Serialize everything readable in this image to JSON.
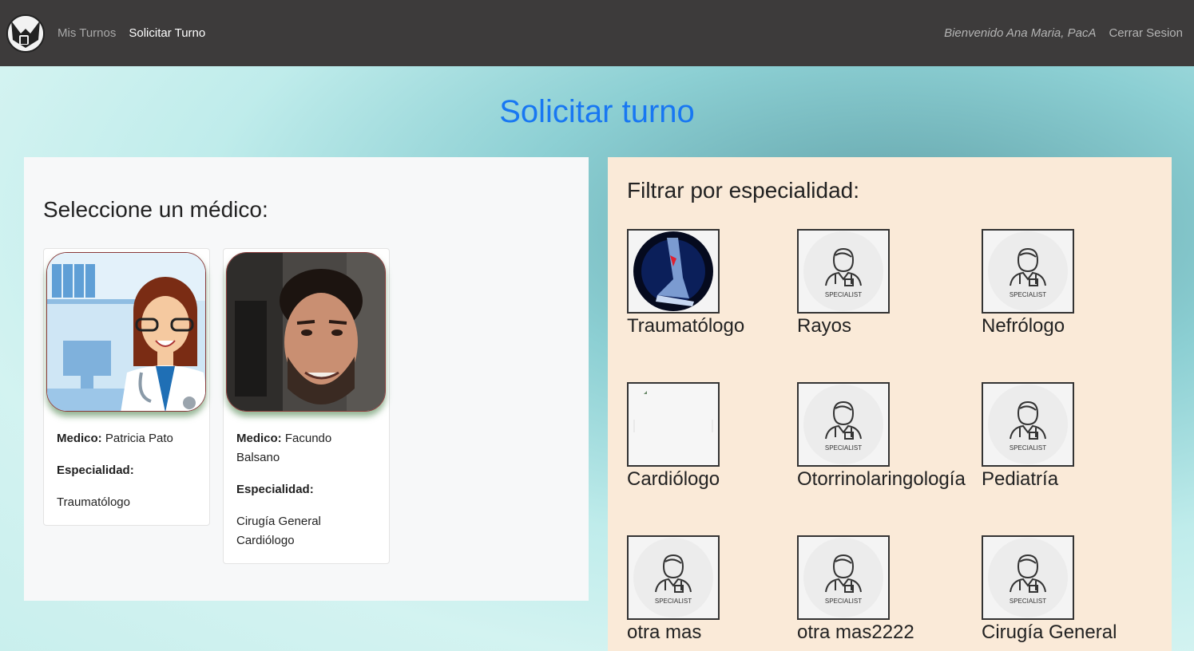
{
  "nav": {
    "links": [
      {
        "label": "Mis Turnos",
        "active": false
      },
      {
        "label": "Solicitar Turno",
        "active": true
      }
    ],
    "welcome": "Bienvenido Ana Maria, PacA",
    "logout": "Cerrar Sesion"
  },
  "page": {
    "title": "Solicitar turno"
  },
  "doctors_panel": {
    "heading": "Seleccione un médico:",
    "doctors": [
      {
        "medico_label": "Medico:",
        "name": "Patricia Pato",
        "especialidad_label": "Especialidad:",
        "specialties": [
          "Traumatólogo"
        ]
      },
      {
        "medico_label": "Medico:",
        "name": "Facundo Balsano",
        "especialidad_label": "Especialidad:",
        "specialties": [
          "Cirugía General",
          "Cardiólogo"
        ]
      }
    ]
  },
  "specialty_panel": {
    "heading": "Filtrar por especialidad:",
    "specialist_caption": "SPECIALIST",
    "specialties": [
      {
        "name": "Traumatólogo",
        "icon": "xray-foot-icon"
      },
      {
        "name": "Rayos",
        "icon": "specialist-icon"
      },
      {
        "name": "Nefrólogo",
        "icon": "specialist-icon"
      },
      {
        "name": "Cardiólogo",
        "icon": "broken-image-icon"
      },
      {
        "name": "Otorrinolaringología",
        "icon": "specialist-icon"
      },
      {
        "name": "Pediatría",
        "icon": "specialist-icon"
      },
      {
        "name": "otra mas",
        "icon": "specialist-icon"
      },
      {
        "name": "otra mas2222",
        "icon": "specialist-icon"
      },
      {
        "name": "Cirugía General",
        "icon": "specialist-icon"
      }
    ]
  },
  "colors": {
    "navbar": "#3d3b3b",
    "title": "#1877f2",
    "left_panel": "#f7f8f9",
    "right_panel": "#faead8"
  }
}
